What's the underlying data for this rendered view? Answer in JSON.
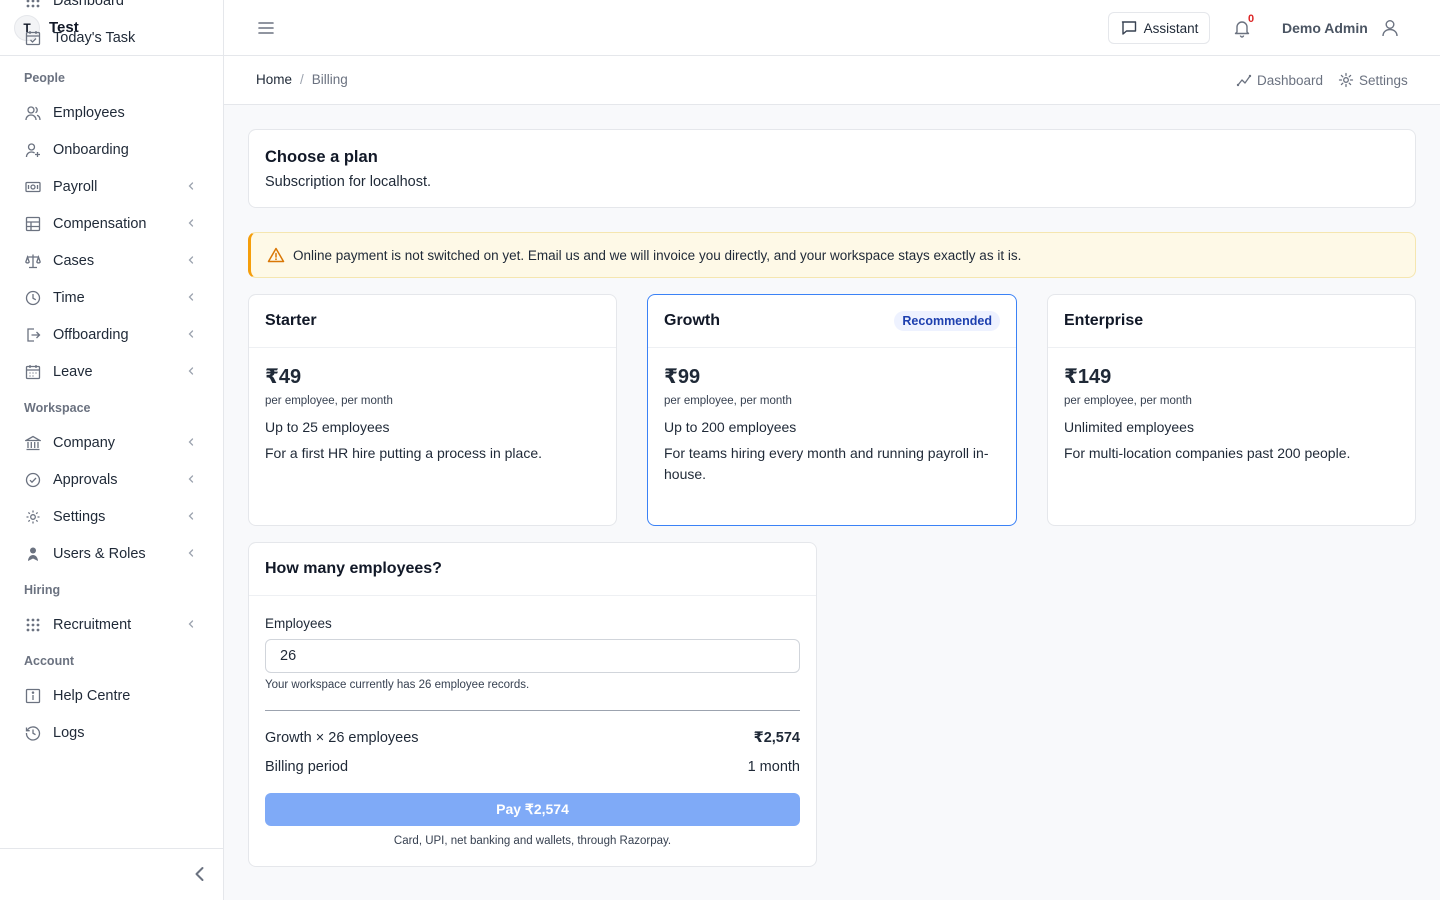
{
  "brand": {
    "initial": "T",
    "name": "Test"
  },
  "sidebar": {
    "top_items": [
      {
        "label": "Dashboard",
        "icon": "grid-icon"
      },
      {
        "label": "Today's Task",
        "icon": "calendar-check-icon"
      }
    ],
    "sections": [
      {
        "title": "People",
        "items": [
          {
            "label": "Employees",
            "icon": "users-icon",
            "has_children": false
          },
          {
            "label": "Onboarding",
            "icon": "user-plus-icon",
            "has_children": false
          },
          {
            "label": "Payroll",
            "icon": "money-icon",
            "has_children": true
          },
          {
            "label": "Compensation",
            "icon": "table-icon",
            "has_children": true
          },
          {
            "label": "Cases",
            "icon": "scale-icon",
            "has_children": true
          },
          {
            "label": "Time",
            "icon": "clock-icon",
            "has_children": true
          },
          {
            "label": "Offboarding",
            "icon": "exit-icon",
            "has_children": true
          },
          {
            "label": "Leave",
            "icon": "calendar-icon",
            "has_children": true
          }
        ]
      },
      {
        "title": "Workspace",
        "items": [
          {
            "label": "Company",
            "icon": "bank-icon",
            "has_children": true
          },
          {
            "label": "Approvals",
            "icon": "check-circle-icon",
            "has_children": true
          },
          {
            "label": "Settings",
            "icon": "gear-icon",
            "has_children": true
          },
          {
            "label": "Users & Roles",
            "icon": "user-shield-icon",
            "has_children": true
          }
        ]
      },
      {
        "title": "Hiring",
        "items": [
          {
            "label": "Recruitment",
            "icon": "grid-icon",
            "has_children": true
          }
        ]
      },
      {
        "title": "Account",
        "items": [
          {
            "label": "Help Centre",
            "icon": "info-icon",
            "has_children": false
          },
          {
            "label": "Logs",
            "icon": "history-icon",
            "has_children": false
          }
        ]
      }
    ]
  },
  "topbar": {
    "assistant_label": "Assistant",
    "notification_count": "0",
    "user_name": "Demo Admin"
  },
  "breadcrumb": {
    "home": "Home",
    "separator": "/",
    "current": "Billing"
  },
  "quick_links": {
    "dashboard": "Dashboard",
    "settings": "Settings"
  },
  "header_card": {
    "title": "Choose a plan",
    "subtitle": "Subscription for localhost."
  },
  "alert": {
    "text": "Online payment is not switched on yet. Email us and we will invoice you directly, and your workspace stays exactly as it is."
  },
  "plans": [
    {
      "name": "Starter",
      "price": "₹49",
      "per": "per employee, per month",
      "limit": "Up to 25 employees",
      "description": "For a first HR hire putting a process in place.",
      "badge": ""
    },
    {
      "name": "Growth",
      "price": "₹99",
      "per": "per employee, per month",
      "limit": "Up to 200 employees",
      "description": "For teams hiring every month and running payroll in-house.",
      "badge": "Recommended"
    },
    {
      "name": "Enterprise",
      "price": "₹149",
      "per": "per employee, per month",
      "limit": "Unlimited employees",
      "description": "For multi-location companies past 200 people.",
      "badge": ""
    }
  ],
  "employees_card": {
    "title": "How many employees?",
    "field_label": "Employees",
    "field_value": "26",
    "hint": "Your workspace currently has 26 employee records.",
    "summary_label": "Growth × 26 employees",
    "summary_value": "₹2,574",
    "period_label": "Billing period",
    "period_value": "1 month",
    "pay_label": "Pay ₹2,574",
    "pay_note": "Card, UPI, net banking and wallets, through Razorpay."
  },
  "colors": {
    "accent": "#2563eb",
    "pay_button": "#7faaf7",
    "alert_bg": "#fef9e7",
    "alert_border": "#f59e0b",
    "badge_bg": "#eef2ff"
  }
}
